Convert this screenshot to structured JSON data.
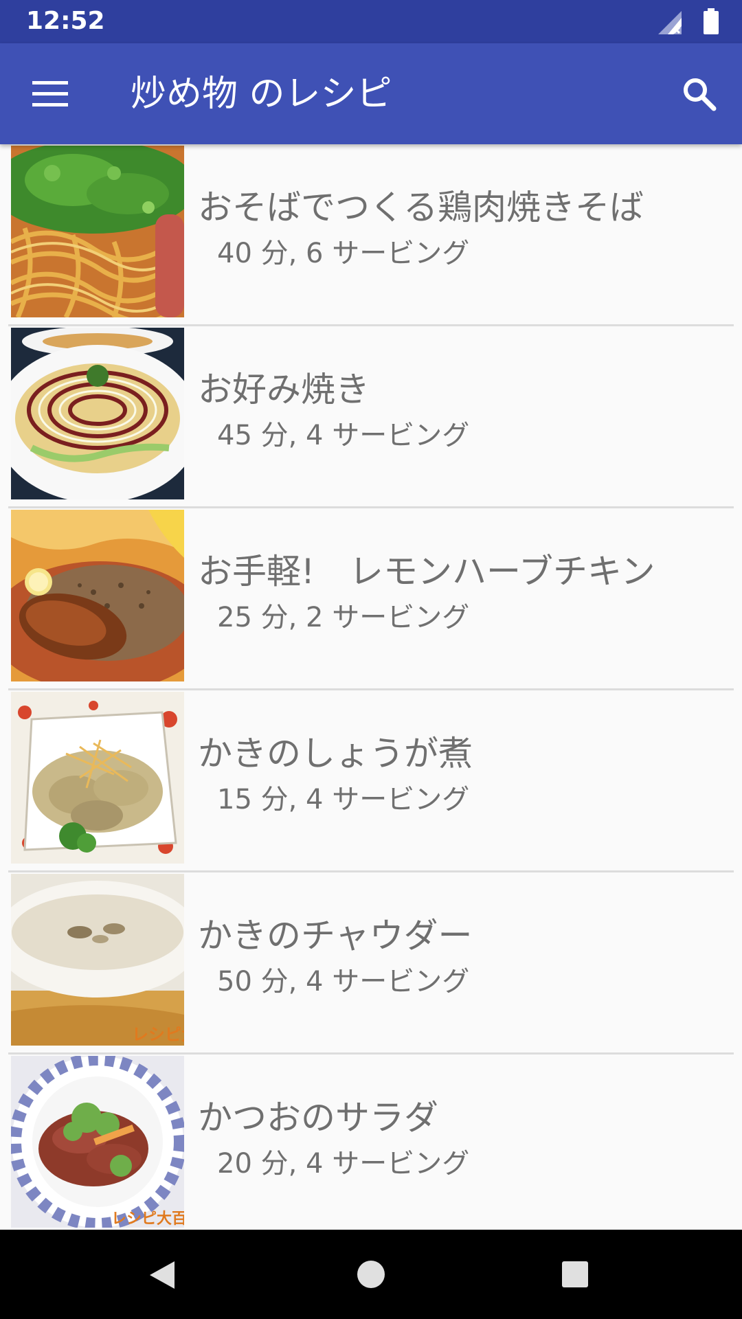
{
  "status_bar": {
    "time": "12:52",
    "icons": [
      "signal-no-data-icon",
      "battery-icon"
    ]
  },
  "app_bar": {
    "title": "炒め物 のレシピ",
    "menu_icon": "hamburger-menu-icon",
    "search_icon": "search-icon"
  },
  "recipes": [
    {
      "name": "おそばでつくる鶏肉焼きそば",
      "meta": "40 分, 6 サービング",
      "thumb": "yakisoba-noodles-photo"
    },
    {
      "name": "お好み焼き",
      "meta": "45 分, 4 サービング",
      "thumb": "okonomiyaki-photo"
    },
    {
      "name": "お手軽!　レモンハーブチキン",
      "meta": "25 分, 2 サービング",
      "thumb": "lemon-herb-chicken-photo"
    },
    {
      "name": "かきのしょうが煮",
      "meta": "15 分, 4 サービング",
      "thumb": "oyster-ginger-photo"
    },
    {
      "name": "かきのチャウダー",
      "meta": "50 分, 4 サービング",
      "thumb": "oyster-chowder-photo"
    },
    {
      "name": "かつおのサラダ",
      "meta": "20 分, 4 サービング",
      "thumb": "bonito-salad-photo"
    }
  ],
  "thumb_watermark": "レシピ大百",
  "nav_bar": {
    "back_icon": "back-triangle-icon",
    "home_icon": "home-circle-icon",
    "recents_icon": "recents-square-icon"
  },
  "colors": {
    "status_bar": "#2f3f9e",
    "app_bar": "#3f51b5",
    "list_bg": "#fafafa",
    "text": "#6f6f6f"
  }
}
